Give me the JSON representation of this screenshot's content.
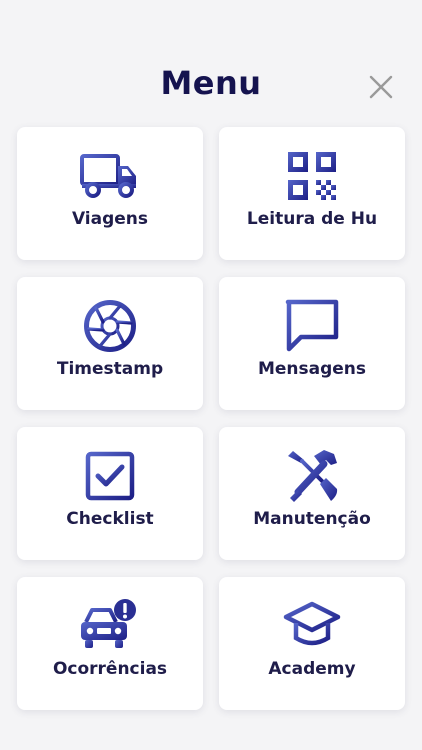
{
  "header": {
    "title": "Menu",
    "close_icon": "close-icon"
  },
  "colors": {
    "icon_gradient_start": "#5565c9",
    "icon_gradient_end": "#1d1f86",
    "title": "#15134f",
    "card_bg": "#ffffff",
    "page_bg": "#f4f4f6",
    "close": "#9a9a9a"
  },
  "menu": {
    "items": [
      {
        "label": "Viagens",
        "icon": "truck-icon"
      },
      {
        "label": "Leitura de Hu",
        "icon": "qr-code-icon"
      },
      {
        "label": "Timestamp",
        "icon": "camera-shutter-icon"
      },
      {
        "label": "Mensagens",
        "icon": "message-icon"
      },
      {
        "label": "Checklist",
        "icon": "checkbox-icon"
      },
      {
        "label": "Manutenção",
        "icon": "tools-icon"
      },
      {
        "label": "Ocorrências",
        "icon": "car-alert-icon"
      },
      {
        "label": "Academy",
        "icon": "graduation-cap-icon"
      }
    ]
  }
}
